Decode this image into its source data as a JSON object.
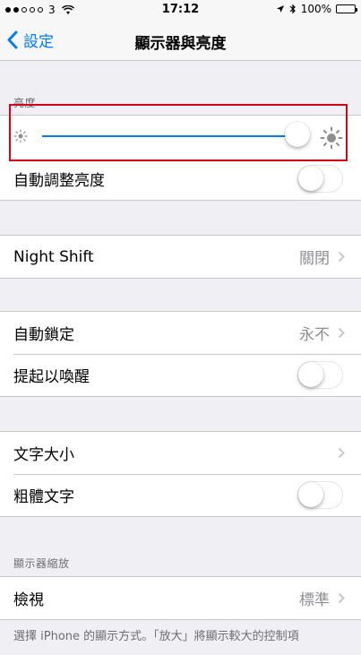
{
  "status_bar": {
    "carrier": "3",
    "time": "17:12",
    "battery": "100%"
  },
  "nav": {
    "back_label": "設定",
    "title": "顯示器與亮度"
  },
  "brightness": {
    "header": "亮度",
    "level": 1.0,
    "auto_label": "自動調整亮度"
  },
  "night_shift": {
    "label": "Night Shift",
    "value": "關閉"
  },
  "lock": {
    "auto_lock_label": "自動鎖定",
    "auto_lock_value": "永不",
    "raise_to_wake_label": "提起以喚醒"
  },
  "text": {
    "text_size_label": "文字大小",
    "bold_text_label": "粗體文字"
  },
  "zoom": {
    "header": "顯示器縮放",
    "view_label": "檢視",
    "view_value": "標準",
    "footer": "選擇 iPhone 的顯示方式。「放大」將顯示較大的控制項"
  },
  "colors": {
    "accent": "#007aff",
    "highlight": "#d0021b",
    "background": "#efeff4"
  },
  "icons": [
    "signal-dots",
    "wifi-icon",
    "location-icon",
    "bluetooth-icon",
    "battery-icon",
    "back-chevron-icon",
    "brightness-low-icon",
    "brightness-high-icon",
    "chevron-right-icon"
  ]
}
